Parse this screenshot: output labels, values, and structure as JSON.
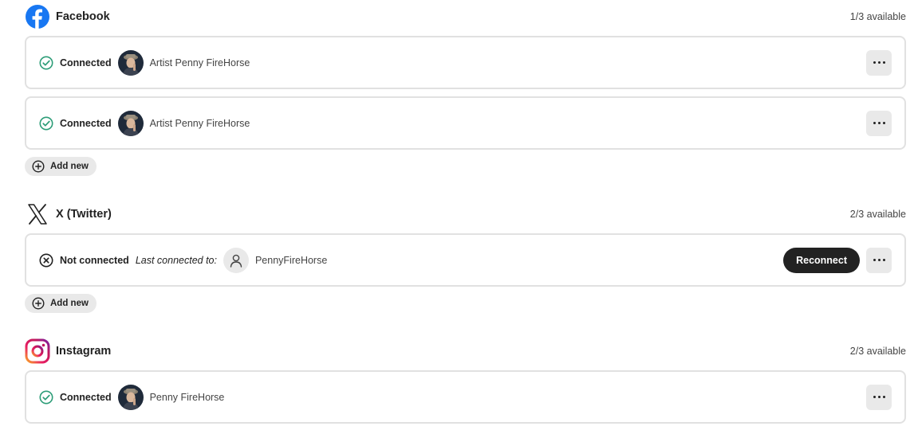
{
  "facebook": {
    "name": "Facebook",
    "availability": "1/3 available",
    "icon": "facebook-icon",
    "brand_color": "#1877F2",
    "accounts": [
      {
        "status": "Connected",
        "name": "Artist Penny FireHorse"
      },
      {
        "status": "Connected",
        "name": "Artist Penny FireHorse"
      }
    ],
    "add_new_label": "Add new"
  },
  "twitter": {
    "name": "X (Twitter)",
    "availability": "2/3 available",
    "icon": "x-logo-icon",
    "accounts": [
      {
        "status": "Not connected",
        "last_connected_label": "Last connected to:",
        "name": "PennyFireHorse",
        "reconnect_label": "Reconnect"
      }
    ],
    "add_new_label": "Add new"
  },
  "instagram": {
    "name": "Instagram",
    "availability": "2/3 available",
    "icon": "instagram-icon",
    "accounts": [
      {
        "status": "Connected",
        "name": "Penny FireHorse"
      }
    ]
  },
  "colors": {
    "connected": "#2d9d78",
    "not_connected": "#222222",
    "reconnect_bg": "#222222"
  }
}
